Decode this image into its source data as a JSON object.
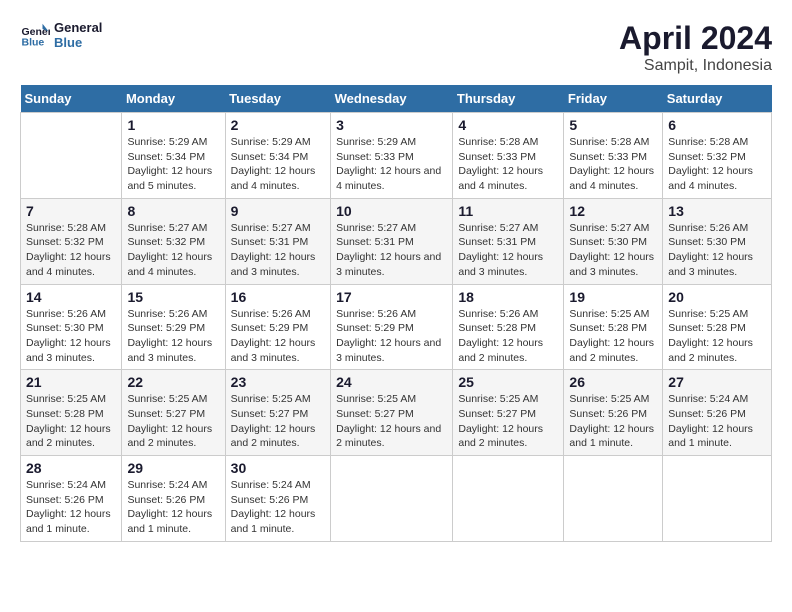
{
  "logo": {
    "line1": "General",
    "line2": "Blue"
  },
  "title": "April 2024",
  "subtitle": "Sampit, Indonesia",
  "days_header": [
    "Sunday",
    "Monday",
    "Tuesday",
    "Wednesday",
    "Thursday",
    "Friday",
    "Saturday"
  ],
  "weeks": [
    [
      {
        "day": "",
        "info": ""
      },
      {
        "day": "1",
        "info": "Sunrise: 5:29 AM\nSunset: 5:34 PM\nDaylight: 12 hours\nand 5 minutes."
      },
      {
        "day": "2",
        "info": "Sunrise: 5:29 AM\nSunset: 5:34 PM\nDaylight: 12 hours\nand 4 minutes."
      },
      {
        "day": "3",
        "info": "Sunrise: 5:29 AM\nSunset: 5:33 PM\nDaylight: 12 hours\nand 4 minutes."
      },
      {
        "day": "4",
        "info": "Sunrise: 5:28 AM\nSunset: 5:33 PM\nDaylight: 12 hours\nand 4 minutes."
      },
      {
        "day": "5",
        "info": "Sunrise: 5:28 AM\nSunset: 5:33 PM\nDaylight: 12 hours\nand 4 minutes."
      },
      {
        "day": "6",
        "info": "Sunrise: 5:28 AM\nSunset: 5:32 PM\nDaylight: 12 hours\nand 4 minutes."
      }
    ],
    [
      {
        "day": "7",
        "info": "Sunrise: 5:28 AM\nSunset: 5:32 PM\nDaylight: 12 hours\nand 4 minutes."
      },
      {
        "day": "8",
        "info": "Sunrise: 5:27 AM\nSunset: 5:32 PM\nDaylight: 12 hours\nand 4 minutes."
      },
      {
        "day": "9",
        "info": "Sunrise: 5:27 AM\nSunset: 5:31 PM\nDaylight: 12 hours\nand 3 minutes."
      },
      {
        "day": "10",
        "info": "Sunrise: 5:27 AM\nSunset: 5:31 PM\nDaylight: 12 hours\nand 3 minutes."
      },
      {
        "day": "11",
        "info": "Sunrise: 5:27 AM\nSunset: 5:31 PM\nDaylight: 12 hours\nand 3 minutes."
      },
      {
        "day": "12",
        "info": "Sunrise: 5:27 AM\nSunset: 5:30 PM\nDaylight: 12 hours\nand 3 minutes."
      },
      {
        "day": "13",
        "info": "Sunrise: 5:26 AM\nSunset: 5:30 PM\nDaylight: 12 hours\nand 3 minutes."
      }
    ],
    [
      {
        "day": "14",
        "info": "Sunrise: 5:26 AM\nSunset: 5:30 PM\nDaylight: 12 hours\nand 3 minutes."
      },
      {
        "day": "15",
        "info": "Sunrise: 5:26 AM\nSunset: 5:29 PM\nDaylight: 12 hours\nand 3 minutes."
      },
      {
        "day": "16",
        "info": "Sunrise: 5:26 AM\nSunset: 5:29 PM\nDaylight: 12 hours\nand 3 minutes."
      },
      {
        "day": "17",
        "info": "Sunrise: 5:26 AM\nSunset: 5:29 PM\nDaylight: 12 hours\nand 3 minutes."
      },
      {
        "day": "18",
        "info": "Sunrise: 5:26 AM\nSunset: 5:28 PM\nDaylight: 12 hours\nand 2 minutes."
      },
      {
        "day": "19",
        "info": "Sunrise: 5:25 AM\nSunset: 5:28 PM\nDaylight: 12 hours\nand 2 minutes."
      },
      {
        "day": "20",
        "info": "Sunrise: 5:25 AM\nSunset: 5:28 PM\nDaylight: 12 hours\nand 2 minutes."
      }
    ],
    [
      {
        "day": "21",
        "info": "Sunrise: 5:25 AM\nSunset: 5:28 PM\nDaylight: 12 hours\nand 2 minutes."
      },
      {
        "day": "22",
        "info": "Sunrise: 5:25 AM\nSunset: 5:27 PM\nDaylight: 12 hours\nand 2 minutes."
      },
      {
        "day": "23",
        "info": "Sunrise: 5:25 AM\nSunset: 5:27 PM\nDaylight: 12 hours\nand 2 minutes."
      },
      {
        "day": "24",
        "info": "Sunrise: 5:25 AM\nSunset: 5:27 PM\nDaylight: 12 hours\nand 2 minutes."
      },
      {
        "day": "25",
        "info": "Sunrise: 5:25 AM\nSunset: 5:27 PM\nDaylight: 12 hours\nand 2 minutes."
      },
      {
        "day": "26",
        "info": "Sunrise: 5:25 AM\nSunset: 5:26 PM\nDaylight: 12 hours\nand 1 minute."
      },
      {
        "day": "27",
        "info": "Sunrise: 5:24 AM\nSunset: 5:26 PM\nDaylight: 12 hours\nand 1 minute."
      }
    ],
    [
      {
        "day": "28",
        "info": "Sunrise: 5:24 AM\nSunset: 5:26 PM\nDaylight: 12 hours\nand 1 minute."
      },
      {
        "day": "29",
        "info": "Sunrise: 5:24 AM\nSunset: 5:26 PM\nDaylight: 12 hours\nand 1 minute."
      },
      {
        "day": "30",
        "info": "Sunrise: 5:24 AM\nSunset: 5:26 PM\nDaylight: 12 hours\nand 1 minute."
      },
      {
        "day": "",
        "info": ""
      },
      {
        "day": "",
        "info": ""
      },
      {
        "day": "",
        "info": ""
      },
      {
        "day": "",
        "info": ""
      }
    ]
  ]
}
